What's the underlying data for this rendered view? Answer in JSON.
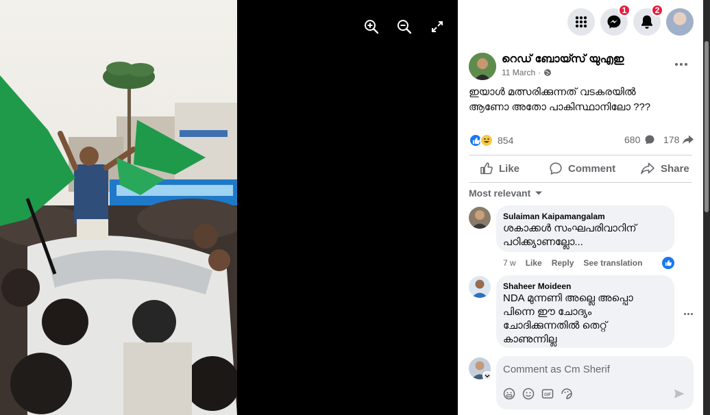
{
  "viewer": {
    "zoom_in_icon": "zoom-in-icon",
    "zoom_out_icon": "zoom-out-icon",
    "fullscreen_icon": "fullscreen-icon"
  },
  "topbar": {
    "messenger_badge": "1",
    "notifications_badge": "2"
  },
  "post": {
    "author": "റെഡ് ബോയ്സ് യുഎഇ",
    "date": "11 March",
    "separator": "·",
    "text_line1": "ഇയാൾ മത്സരിക്കുന്നത് വടകരയിൽ",
    "text_line2": "ആണോ അതോ പാകിസ്ഥാനിലോ ???",
    "reactions_count": "854",
    "comments_count": "680",
    "shares_count": "178",
    "like_label": "Like",
    "comment_label": "Comment",
    "share_label": "Share"
  },
  "comments_section": {
    "sort_label": "Most relevant",
    "comments": [
      {
        "name": "Sulaiman Kaipamangalam",
        "line1": "ശകാക്കൾ സംഘപരിവാറിന്",
        "line2": "പഠിക്ക്യാണല്ലോ...",
        "age": "7 w",
        "like": "Like",
        "reply": "Reply",
        "translate": "See translation"
      },
      {
        "name": "Shaheer Moideen",
        "line1": "NDA മുന്നണി അല്ലെ അപ്പൊ",
        "line2": "പിന്നെ ഈ ചോദ്യം",
        "line3": "ചോദിക്കുന്നതിൽ തെറ്റ്",
        "line4": "കാണുന്നില്ല"
      }
    ],
    "composer_placeholder": "Comment as Cm Sherif"
  },
  "colors": {
    "accent": "#1877f2",
    "badge": "#e41e3f",
    "flag_green": "#1f9a4b"
  }
}
